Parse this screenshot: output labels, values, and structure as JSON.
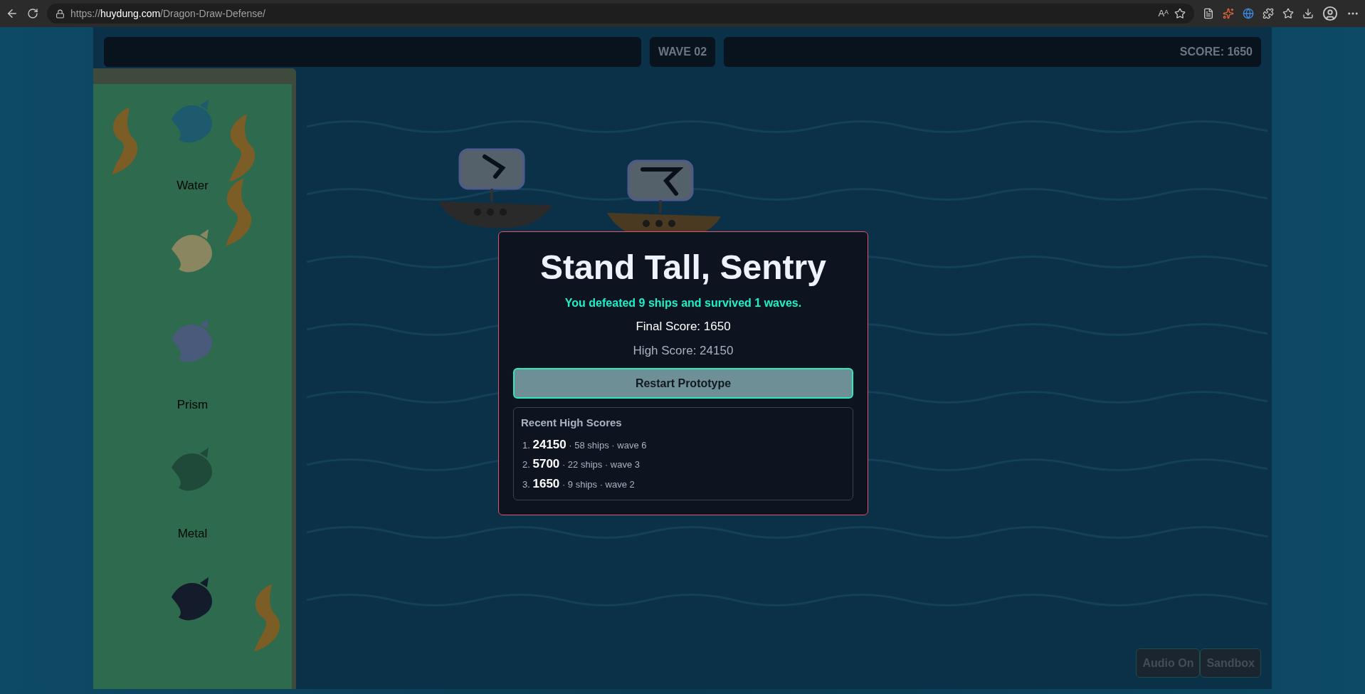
{
  "browser": {
    "url": "https://**huydung.com**/Dragon-Draw-Defense/",
    "read_aloud": "Aᴬ"
  },
  "hud": {
    "wave": "WAVE 02",
    "score": "SCORE: 1650"
  },
  "dragon_panel": {
    "items": [
      {
        "kind": "water",
        "label": "Water"
      },
      {
        "kind": "light"
      },
      {
        "kind": "ice",
        "label": "Prism"
      },
      {
        "kind": "leaf",
        "label": "Metal"
      },
      {
        "kind": "shadow"
      }
    ]
  },
  "ships": [
    {
      "kind": "airship"
    },
    {
      "kind": "longship"
    }
  ],
  "game_over": {
    "title": "Stand Tall, Sentry",
    "summary": "You defeated 9 ships and survived 1 waves.",
    "final_score": "Final Score: 1650",
    "high_score": "High Score: 24150",
    "restart_button": "Restart Prototype",
    "recent": {
      "title": "Recent High Scores",
      "entries": [
        "1. **24150** · 58 ships · wave 6",
        "2. **5700** · 22 ships · wave 3",
        "3. **1650** · 9 ships · wave 2"
      ]
    }
  },
  "controls": [
    {
      "label": "Audio On"
    },
    {
      "label": "Sandbox"
    }
  ]
}
